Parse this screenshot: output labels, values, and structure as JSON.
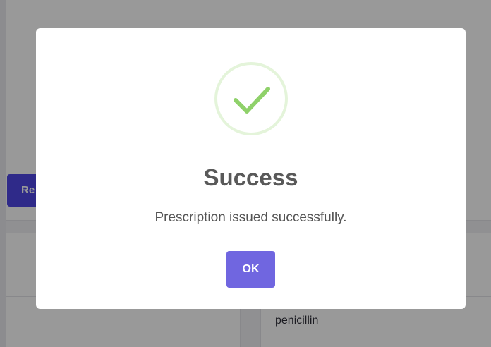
{
  "background": {
    "primary_button_label": "Re",
    "table_cell_text": "penicillin"
  },
  "modal": {
    "icon": "success-checkmark-icon",
    "title": "Success",
    "message": "Prescription issued successfully.",
    "confirm_label": "OK"
  },
  "colors": {
    "overlay": "rgba(0,0,0,0.4)",
    "background_button": "#4f46e5",
    "confirm_button": "#7066e0",
    "success_check": "#a5dc86",
    "title_text": "#595959"
  }
}
